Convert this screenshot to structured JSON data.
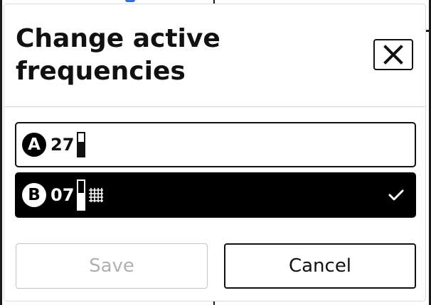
{
  "dialog": {
    "title": "Change active frequencies",
    "close_icon": "close-x-icon"
  },
  "frequencies": [
    {
      "badge": "A",
      "number": "27",
      "signal_icon": "signal-bar-icon",
      "selected": false
    },
    {
      "badge": "B",
      "number": "07",
      "signal_icon": "signal-bar-icon",
      "grid_icon": "grid-pattern-icon",
      "selected": true,
      "check_icon": "checkmark-icon"
    }
  ],
  "buttons": {
    "save_label": "Save",
    "save_enabled": false,
    "cancel_label": "Cancel"
  },
  "colors": {
    "text": "#111111",
    "selected_bg": "#000000",
    "disabled_text": "#b0b0b0",
    "disabled_border": "#c4c4c4"
  }
}
